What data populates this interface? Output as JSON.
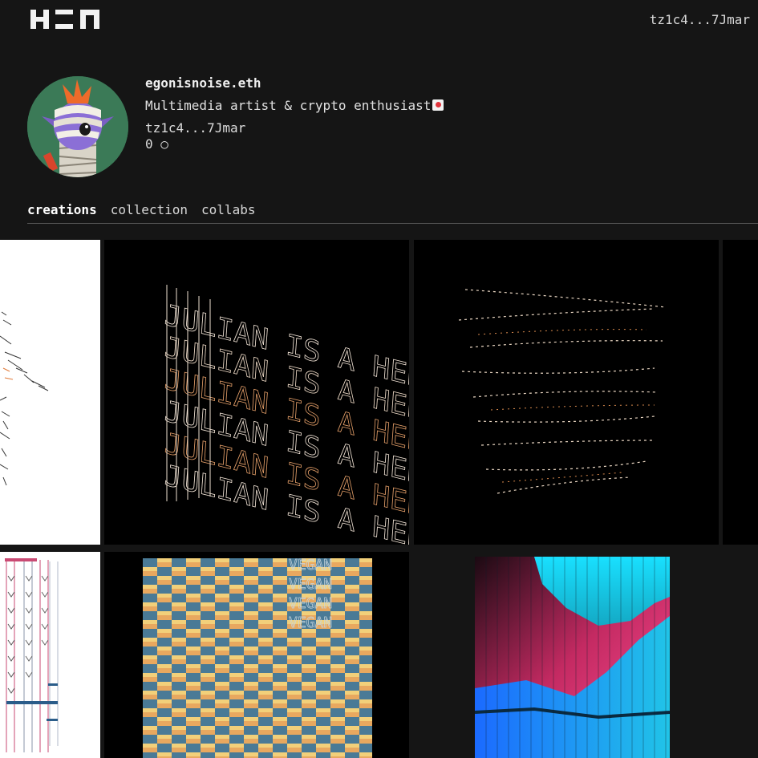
{
  "header": {
    "logo_icon": "hen-logo-icon",
    "wallet_address": "tz1c4...7Jmar"
  },
  "profile": {
    "avatar_icon": "mummy-avatar-icon",
    "name": "egonisnoise.eth",
    "bio": "Multimedia artist & crypto enthusiast",
    "bio_icon": "flag-emoji-icon",
    "address": "tz1c4...7Jmar",
    "balance": "0 ○"
  },
  "tabs": [
    {
      "label": "creations",
      "active": true
    },
    {
      "label": "collection",
      "active": false
    },
    {
      "label": "collabs",
      "active": false
    }
  ],
  "artwork_text": {
    "julian": "JULIAN IS A HERO!",
    "vegan": "VEGAN"
  },
  "colors": {
    "background": "#151515",
    "tile_black": "#000000",
    "tile_white": "#ffffff",
    "accent_orange": "#e0803a",
    "accent_pink": "#ff3d8b",
    "accent_cyan": "#19e0ff"
  }
}
